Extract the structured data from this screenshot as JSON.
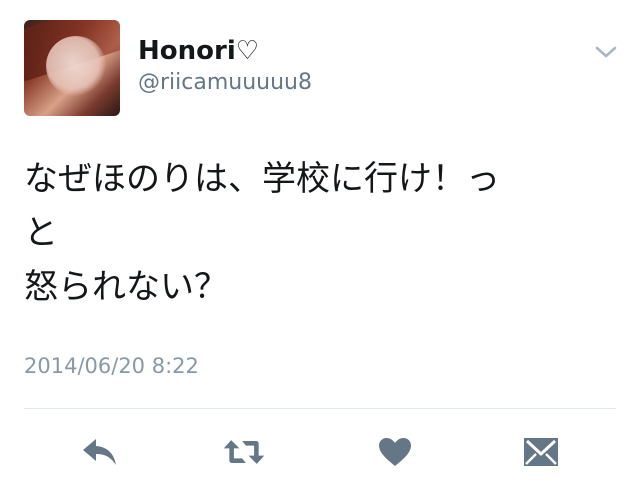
{
  "tweet": {
    "user": {
      "name": "Honori♡",
      "handle": "@riicamuuuuu8"
    },
    "text_lines": [
      "なぜほのりは、学校に行け！っ",
      "と",
      "怒られない？"
    ],
    "timestamp": "2014/06/20 8:22"
  },
  "actions": [
    {
      "icon": "reply-icon"
    },
    {
      "icon": "retweet-icon"
    },
    {
      "icon": "heart-icon"
    },
    {
      "icon": "mail-icon"
    }
  ],
  "colors": {
    "text": "#14171a",
    "secondary": "#657786",
    "icon": "#657786",
    "divider": "#e1e8ed"
  }
}
